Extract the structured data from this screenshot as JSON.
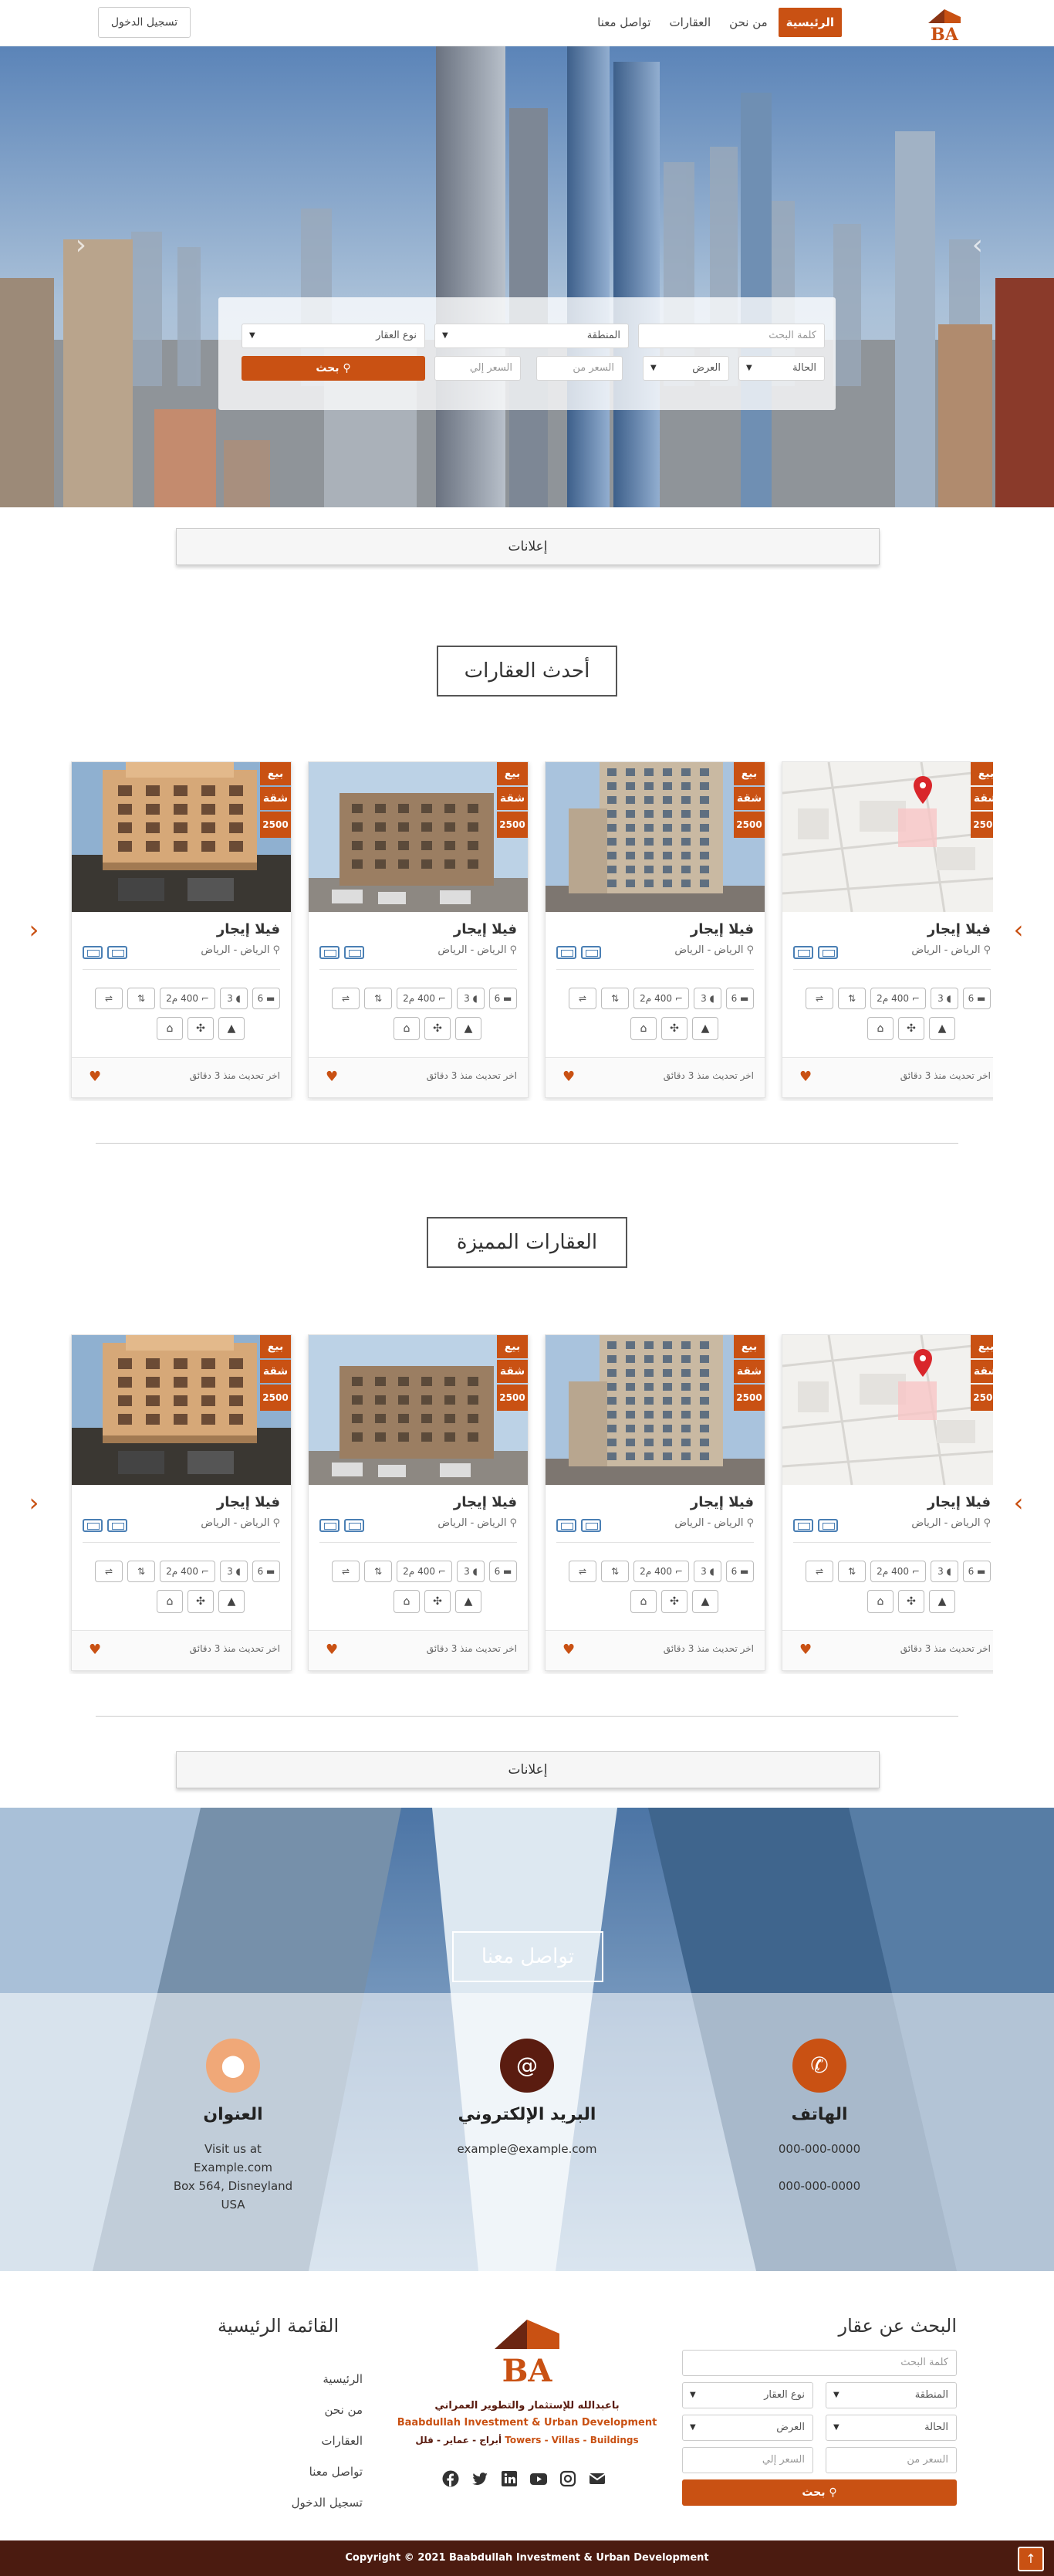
{
  "brand": {
    "accent": "#c95113",
    "dark": "#4b1b10",
    "logo_icon": "ba-logo-icon"
  },
  "nav": {
    "items": [
      {
        "label": "الرئيسية",
        "active": true
      },
      {
        "label": "من نحن"
      },
      {
        "label": "العقارات"
      },
      {
        "label": "تواصل معنا"
      }
    ],
    "login": "تسجيل الدخول"
  },
  "search": {
    "keyword_placeholder": "كلمة البحث",
    "region": "المنطقة",
    "type": "نوع العقار",
    "status": "الحالة",
    "offer": "العرض",
    "price_from": "السعر من",
    "price_to": "السعر إلي",
    "button": "بحث"
  },
  "ads_label": "إعلانات",
  "latest_title": "أحدث العقارات",
  "featured_title": "العقارات المميزة",
  "card": {
    "tag_sale": "بيع",
    "tag_type": "شقة",
    "tag_price": "2500",
    "title": "فيلا إيجار",
    "location": "الرياض - الرياض",
    "rooms": "6",
    "baths": "3",
    "area": "400",
    "area_unit": "م2",
    "updated": "اخر تحديث منذ 3 دقائق"
  },
  "contact": {
    "title": "تواصل معنا",
    "phone_title": "الهاتف",
    "phones": [
      "000-000-0000",
      "000-000-0000"
    ],
    "email_title": "البريد الإلكتروني",
    "email": "example@example.com",
    "address_title": "العنوان",
    "address_lines": [
      "Visit us at",
      "Example.com",
      "Box 564, Disneyland",
      "USA"
    ]
  },
  "footer": {
    "search_title": "البحث عن عقار",
    "menu_title": "القائمة الرئيسية",
    "menu": [
      "الرئيسية",
      "من نحن",
      "العقارات",
      "تواصل معنا",
      "تسجيل الدخول"
    ],
    "brand_ar": "باعبدالله للإستثمار والتطوير العمراني",
    "brand_en": "Baabdullah Investment & Urban Development",
    "tagline_en": "Towers - Villas - Buildings",
    "tagline_ar": "أبراج - عماير - فلل",
    "social": [
      "facebook-icon",
      "twitter-icon",
      "linkedin-icon",
      "youtube-icon",
      "instagram-icon",
      "mail-icon"
    ]
  },
  "copyright": "Copyright © 2021 Baabdullah Investment & Urban Development"
}
